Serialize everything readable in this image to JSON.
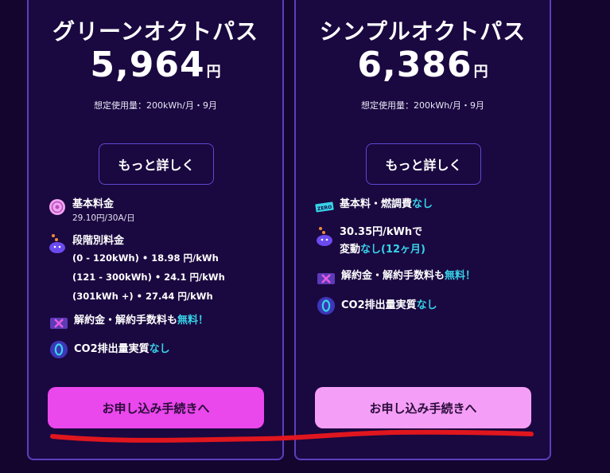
{
  "plans": {
    "left": {
      "title": "グリーンオクトパス",
      "price": "5,964",
      "currency": "円",
      "usage_note": "想定使用量：200kWh/月・9月",
      "more_label": "もっと詳しく",
      "basic_fee_title": "基本料金",
      "basic_fee_value": "29.10円/30A/日",
      "tiered_title": "段階別料金",
      "tiers": [
        "(0 - 120kWh) • 18.98 円/kWh",
        "(121 - 300kWh) • 24.1 円/kWh",
        "(301kWh +) • 27.44 円/kWh"
      ],
      "cancel_text": "解約金・解約手数料も",
      "cancel_highlight": "無料！",
      "co2_text": "CO2排出量実質",
      "co2_highlight": "なし",
      "apply_label": "お申し込み手続きへ"
    },
    "right": {
      "title": "シンプルオクトパス",
      "price": "6,386",
      "currency": "円",
      "usage_note": "想定使用量：200kWh/月・9月",
      "more_label": "もっと詳しく",
      "zero_badge": "ZERO",
      "basic_text": "基本料・燃調費",
      "basic_highlight": "なし",
      "rate_line1": "30.35円/kWhで",
      "rate_line2": "変動",
      "rate_highlight": "なし(12ヶ月)",
      "cancel_text": "解約金・解約手数料も",
      "cancel_highlight": "無料！",
      "co2_text": "CO2排出量実質",
      "co2_highlight": "なし",
      "apply_label": "お申し込み手続きへ"
    }
  },
  "colors": {
    "background": "#14052e",
    "card": "#1a0840",
    "card_border": "#5b3fbf",
    "highlight": "#37d3e8",
    "apply_left": "#ea47ec",
    "apply_right": "#f59ef7",
    "annotation": "#e0161e"
  },
  "icons": {
    "basic_fee": "coin-icon",
    "tiered": "octopus-icon",
    "cancel": "x-ticket-icon",
    "co2": "zero-badge-icon",
    "zero": "zero-tag-icon"
  }
}
